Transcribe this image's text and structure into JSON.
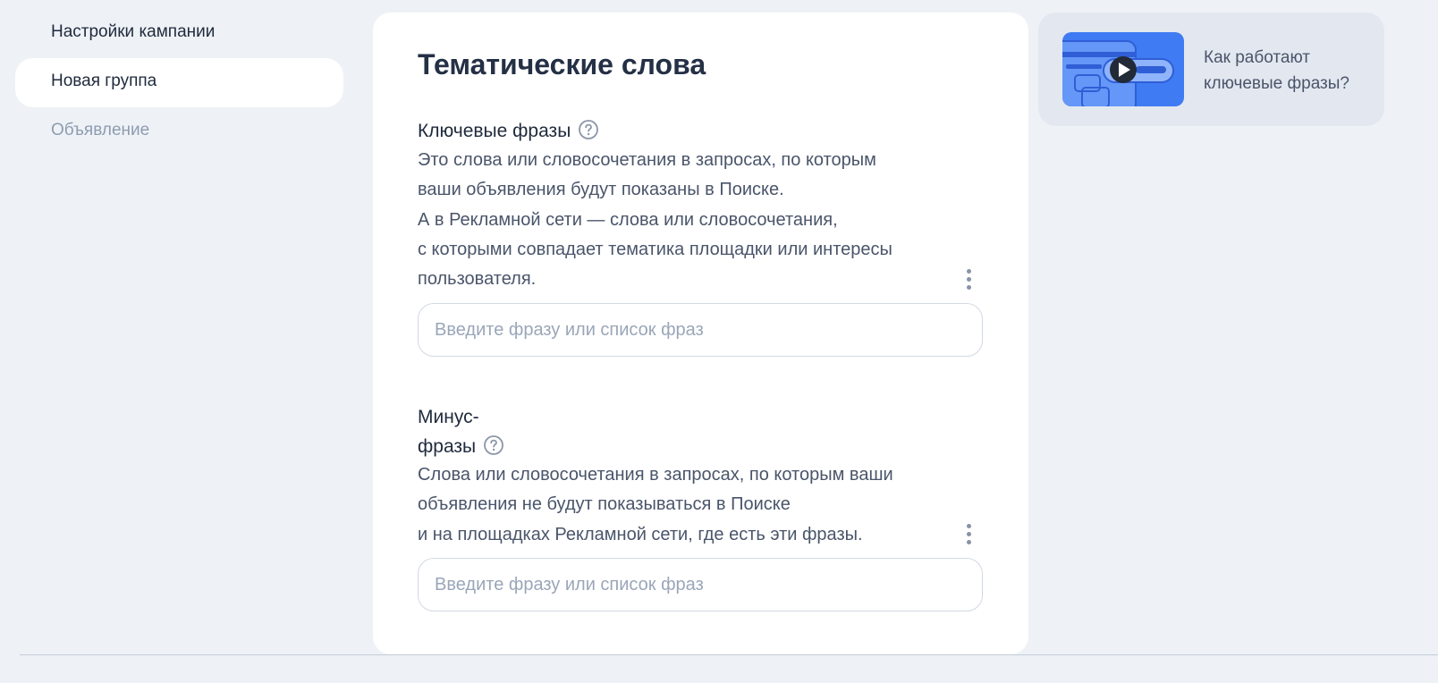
{
  "sidebar": {
    "items": [
      {
        "label": "Настройки кампании",
        "state": "default"
      },
      {
        "label": "Новая группа",
        "state": "active"
      },
      {
        "label": "Объявление",
        "state": "disabled"
      }
    ]
  },
  "main": {
    "title": "Тематические слова",
    "keywords": {
      "label": "Ключевые фразы",
      "help_icon": "question-circle-icon",
      "description": [
        "Это слова или словосочетания в запросах, по которым",
        "ваши объявления будут показаны в Поиске.",
        "А в Рекламной сети — слова или словосочетания,",
        "с которыми совпадает тематика площадки или интересы",
        "пользователя."
      ],
      "input_value": "",
      "input_placeholder": "Введите фразу или список фраз",
      "menu_icon": "kebab-menu-icon"
    },
    "minus_phrases": {
      "label_line1": "Минус-",
      "label_line2": "фразы",
      "help_icon": "question-circle-icon",
      "description": [
        "Слова или словосочетания в запросах, по которым ваши",
        "объявления не будут показываться в Поиске",
        "и на площадках Рекламной сети, где есть эти фразы."
      ],
      "input_value": "",
      "input_placeholder": "Введите фразу или список фраз",
      "menu_icon": "kebab-menu-icon"
    }
  },
  "promo": {
    "line1": "Как работают",
    "line2": "ключевые фразы?",
    "thumbnail_icon": "play-icon"
  },
  "colors": {
    "background": "#eef2f6",
    "card": "#ffffff",
    "promo_background": "#e3e8f0",
    "thumbnail_blue": "#3f7bf3",
    "muted_text": "#8e9cb1"
  }
}
